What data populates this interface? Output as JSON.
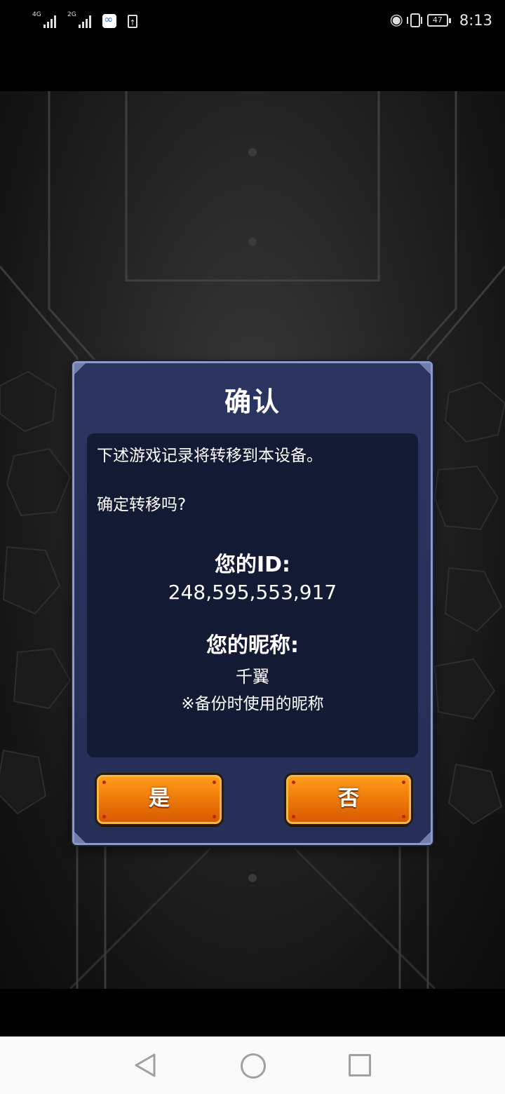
{
  "status_bar": {
    "sim1_label": "4G",
    "sim2_label": "2G",
    "battery_level": "47",
    "time": "8:13",
    "icons": [
      "signal-icon",
      "app-notification-icon",
      "upload-icon",
      "eye-icon",
      "vibrate-icon",
      "battery-icon"
    ]
  },
  "dialog": {
    "title": "确认",
    "message_line1": "下述游戏记录将转移到本设备。",
    "message_line2": "确定转移吗?",
    "id_label": "您的ID:",
    "id_value": "248,595,553,917",
    "nickname_label": "您的昵称:",
    "nickname_value": "千翼",
    "nickname_note": "※备份时使用的昵称",
    "yes_label": "是",
    "no_label": "否"
  },
  "colors": {
    "dialog_bg": "#2b3560",
    "content_bg": "#131a33",
    "button_orange": "#f07d0a",
    "button_border": "#f6b64a"
  },
  "nav_bar": {
    "icons": [
      "back-icon",
      "home-icon",
      "recent-apps-icon"
    ]
  }
}
